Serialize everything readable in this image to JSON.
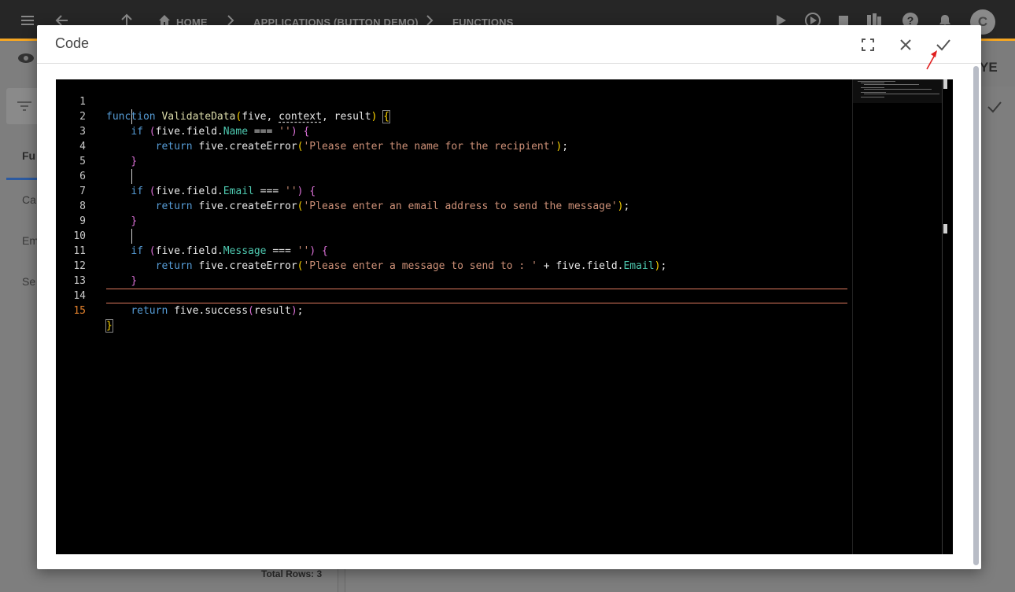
{
  "breadcrumb": {
    "home": "HOME",
    "app": "APPLICATIONS (BUTTON DEMO)",
    "page": "FUNCTIONS"
  },
  "avatar_initial": "C",
  "background": {
    "tab_fragment": "Fu",
    "rows": [
      "Ca",
      "Em",
      "Se"
    ],
    "total_rows": "Total Rows: 3",
    "right_fragment": "YE"
  },
  "modal": {
    "title": "Code",
    "icons": [
      "fullscreen-icon",
      "close-icon",
      "check-icon"
    ]
  },
  "code_lines": [
    {
      "n": "1"
    },
    {
      "n": "2"
    },
    {
      "n": "3"
    },
    {
      "n": "4"
    },
    {
      "n": "5"
    },
    {
      "n": "6"
    },
    {
      "n": "7"
    },
    {
      "n": "8"
    },
    {
      "n": "9"
    },
    {
      "n": "10"
    },
    {
      "n": "11"
    },
    {
      "n": "12"
    },
    {
      "n": "13"
    },
    {
      "n": "14"
    },
    {
      "n": "15"
    }
  ],
  "code": {
    "l1": {
      "kw": "function",
      "fn": "ValidateData",
      "p1": "five",
      "p2": "context",
      "p3": "result"
    },
    "l2": {
      "kw": "if",
      "obj": "five.field.",
      "prop": "Name",
      "op": " === ",
      "str": "''"
    },
    "l3": {
      "kw": "return",
      "call": "five.createError",
      "str": "'Please enter the name for the recipient'"
    },
    "l6": {
      "kw": "if",
      "obj": "five.field.",
      "prop": "Email",
      "op": " === ",
      "str": "''"
    },
    "l7": {
      "kw": "return",
      "call": "five.createError",
      "str": "'Please enter an email address to send the message'"
    },
    "l10": {
      "kw": "if",
      "obj": "five.field.",
      "prop": "Message",
      "op": " === ",
      "str": "''"
    },
    "l11": {
      "kw": "return",
      "call": "five.createError",
      "str": "'Please enter a message to send to : '",
      "plus": " + ",
      "obj": "five.field.",
      "prop": "Email"
    },
    "l14": {
      "kw": "return",
      "call": "five.success",
      "arg": "result"
    }
  },
  "colors": {
    "accent": "#f5a623",
    "keyword": "#569cd6",
    "function": "#dcdcaa",
    "string": "#ce9178",
    "property": "#4ec9b0",
    "bracket": "#ffd700",
    "annotation_arrow": "#e02020"
  }
}
